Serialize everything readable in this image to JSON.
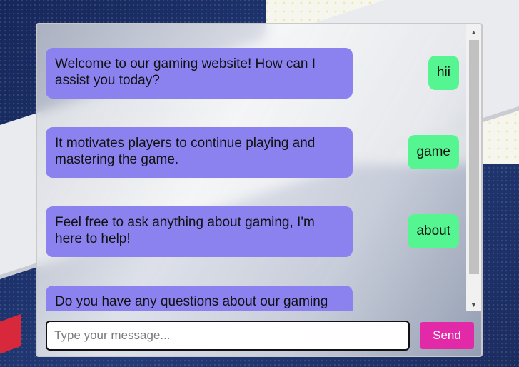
{
  "chat": {
    "messages": [
      {
        "bot": "Welcome to our gaming website! How can I assist you today?",
        "user": "hii"
      },
      {
        "bot": "It motivates players to continue playing and mastering the game.",
        "user": "game"
      },
      {
        "bot": "Feel free to ask anything about gaming, I'm here to help!",
        "user": "about"
      },
      {
        "bot": "Do you have any questions about our gaming"
      }
    ]
  },
  "composer": {
    "placeholder": "Type your message...",
    "send_label": "Send"
  },
  "colors": {
    "bot_bubble": "#8b82f0",
    "user_bubble": "#55f591",
    "send_button": "#e229a8"
  },
  "icons": {
    "scroll_up": "arrow-up-icon",
    "scroll_down": "arrow-down-icon"
  }
}
